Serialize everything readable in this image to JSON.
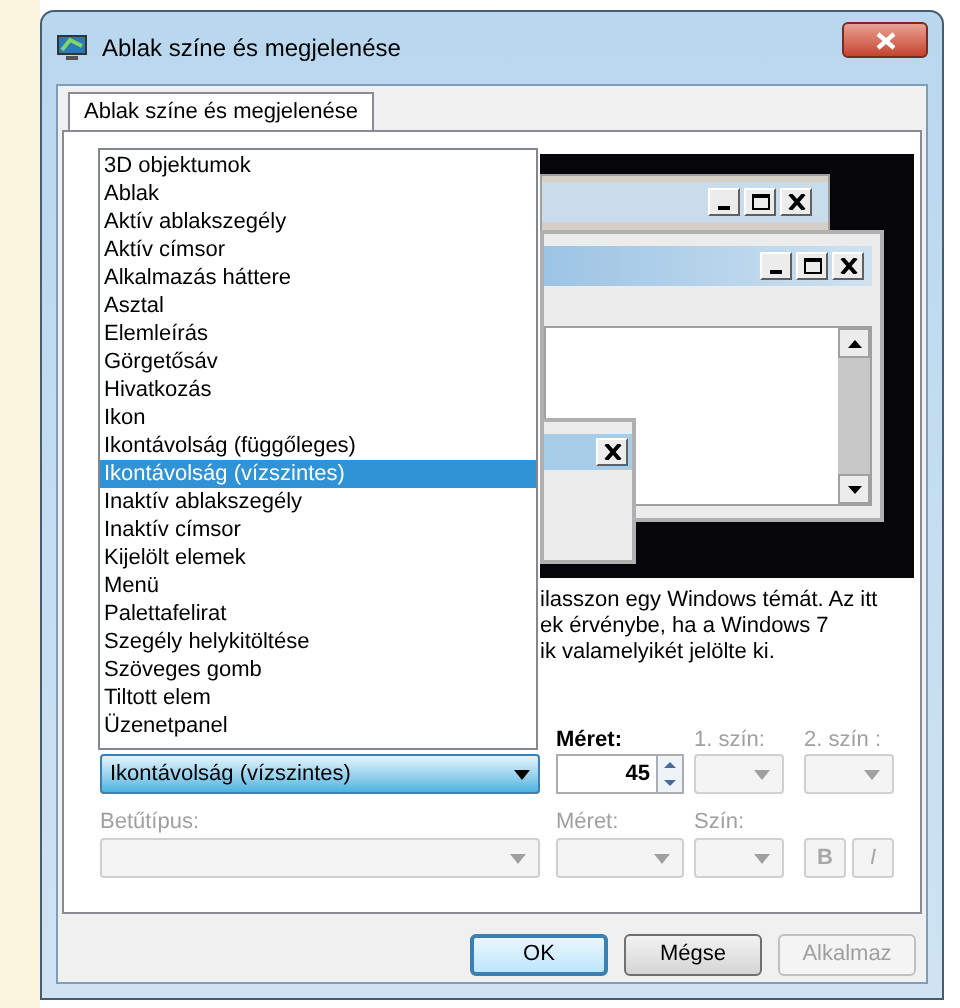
{
  "window": {
    "title": "Ablak színe és megjelenése"
  },
  "tabs": [
    {
      "label": "Ablak színe és megjelenése",
      "selected": true
    }
  ],
  "item_list": {
    "expanded": true,
    "options": [
      {
        "label": "3D objektumok",
        "selected": false
      },
      {
        "label": "Ablak",
        "selected": false
      },
      {
        "label": "Aktív ablakszegély",
        "selected": false
      },
      {
        "label": "Aktív címsor",
        "selected": false
      },
      {
        "label": "Alkalmazás háttere",
        "selected": false
      },
      {
        "label": "Asztal",
        "selected": false
      },
      {
        "label": "Elemleírás",
        "selected": false
      },
      {
        "label": "Görgetősáv",
        "selected": false
      },
      {
        "label": "Hivatkozás",
        "selected": false
      },
      {
        "label": "Ikon",
        "selected": false
      },
      {
        "label": "Ikontávolság (függőleges)",
        "selected": false
      },
      {
        "label": "Ikontávolság (vízszintes)",
        "selected": true
      },
      {
        "label": "Inaktív ablakszegély",
        "selected": false
      },
      {
        "label": "Inaktív címsor",
        "selected": false
      },
      {
        "label": "Kijelölt elemek",
        "selected": false
      },
      {
        "label": "Menü",
        "selected": false
      },
      {
        "label": "Palettafelirat",
        "selected": false
      },
      {
        "label": "Szegély helykitöltése",
        "selected": false
      },
      {
        "label": "Szöveges gomb",
        "selected": false
      },
      {
        "label": "Tiltott elem",
        "selected": false
      },
      {
        "label": "Üzenetpanel",
        "selected": false
      }
    ]
  },
  "item_combo": {
    "value": "Ikontávolság (vízszintes)"
  },
  "description_lines": [
    "ilasszon egy Windows témát. Az itt",
    "ek érvénybe, ha a Windows 7",
    "ik valamelyikét jelölte ki."
  ],
  "size": {
    "label": "Méret:",
    "value": "45",
    "disabled": false
  },
  "color1": {
    "label": "1. szín:",
    "disabled": true
  },
  "color2": {
    "label": "2. szín :",
    "disabled": true
  },
  "font": {
    "label": "Betűtípus:",
    "disabled": true
  },
  "font_size": {
    "label": "Méret:",
    "disabled": true
  },
  "font_color": {
    "label": "Szín:",
    "disabled": true
  },
  "style_buttons": [
    {
      "label": "B",
      "kind": "bold",
      "disabled": true
    },
    {
      "label": "I",
      "kind": "italic",
      "disabled": true
    }
  ],
  "buttons": [
    {
      "label": "OK",
      "kind": "default",
      "disabled": false
    },
    {
      "label": "Mégse",
      "kind": "normal",
      "disabled": false
    },
    {
      "label": "Alkalmaz",
      "kind": "normal",
      "disabled": true
    }
  ]
}
